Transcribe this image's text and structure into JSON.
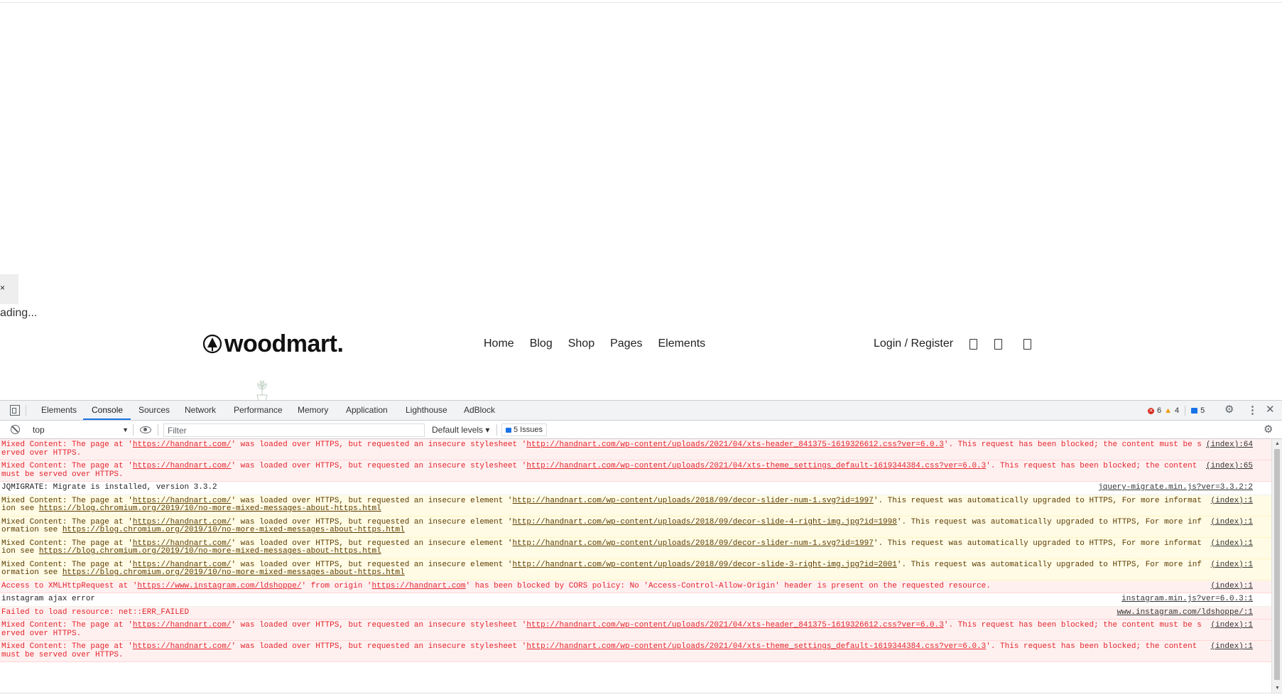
{
  "page": {
    "loader_close": "×",
    "loading_text": "ading...",
    "logo_text": "woodmart.",
    "nav": [
      "Home",
      "Blog",
      "Shop",
      "Pages",
      "Elements"
    ],
    "login": "Login / Register"
  },
  "devtools": {
    "tabs": [
      "Elements",
      "Console",
      "Sources",
      "Network",
      "Performance",
      "Memory",
      "Application",
      "Lighthouse",
      "AdBlock"
    ],
    "active_tab": "Console",
    "error_count": "6",
    "warning_count": "4",
    "message_count": "5",
    "context": "top",
    "filter_placeholder": "Filter",
    "levels": "Default levels ▾",
    "issues": "5 Issues",
    "messages": [
      {
        "level": "error",
        "parts": [
          "Mixed Content: The page at '",
          {
            "link": "https://handnart.com/"
          },
          "' was loaded over HTTPS, but requested an insecure stylesheet '",
          {
            "link": "http://handnart.com/wp-content/uploads/2021/04/xts-header_841375-1619326612.css?ver=6.0.3"
          },
          "'. This request has been blocked; the content must be served over HTTPS."
        ],
        "source": "(index):64"
      },
      {
        "level": "error",
        "parts": [
          "Mixed Content: The page at '",
          {
            "link": "https://handnart.com/"
          },
          "' was loaded over HTTPS, but requested an insecure stylesheet '",
          {
            "link": "http://handnart.com/wp-content/uploads/2021/04/xts-theme_settings_default-1619344384.css?ver=6.0.3"
          },
          "'. This request has been blocked; the content must be served over HTTPS."
        ],
        "source": "(index):65"
      },
      {
        "level": "info",
        "parts": [
          "JQMIGRATE: Migrate is installed, version 3.3.2"
        ],
        "source": "jquery-migrate.min.js?ver=3.3.2:2"
      },
      {
        "level": "warning",
        "parts": [
          "Mixed Content: The page at '",
          {
            "link": "https://handnart.com/"
          },
          "' was loaded over HTTPS, but requested an insecure element '",
          {
            "link": "http://handnart.com/wp-content/uploads/2018/09/decor-slider-num-1.svg?id=1997"
          },
          "'. This request was automatically upgraded to HTTPS, For more information see ",
          {
            "link": "https://blog.chromium.org/2019/10/no-more-mixed-messages-about-https.html"
          }
        ],
        "source": "(index):1"
      },
      {
        "level": "warning",
        "parts": [
          "Mixed Content: The page at '",
          {
            "link": "https://handnart.com/"
          },
          "' was loaded over HTTPS, but requested an insecure element '",
          {
            "link": "http://handnart.com/wp-content/uploads/2018/09/decor-slide-4-right-img.jpg?id=1998"
          },
          "'. This request was automatically upgraded to HTTPS, For more information see ",
          {
            "link": "https://blog.chromium.org/2019/10/no-more-mixed-messages-about-https.html"
          }
        ],
        "source": "(index):1"
      },
      {
        "level": "warning",
        "parts": [
          "Mixed Content: The page at '",
          {
            "link": "https://handnart.com/"
          },
          "' was loaded over HTTPS, but requested an insecure element '",
          {
            "link": "http://handnart.com/wp-content/uploads/2018/09/decor-slider-num-1.svg?id=1997"
          },
          "'. This request was automatically upgraded to HTTPS, For more information see ",
          {
            "link": "https://blog.chromium.org/2019/10/no-more-mixed-messages-about-https.html"
          }
        ],
        "source": "(index):1"
      },
      {
        "level": "warning",
        "parts": [
          "Mixed Content: The page at '",
          {
            "link": "https://handnart.com/"
          },
          "' was loaded over HTTPS, but requested an insecure element '",
          {
            "link": "http://handnart.com/wp-content/uploads/2018/09/decor-slide-3-right-img.jpg?id=2001"
          },
          "'. This request was automatically upgraded to HTTPS, For more information see ",
          {
            "link": "https://blog.chromium.org/2019/10/no-more-mixed-messages-about-https.html"
          }
        ],
        "source": "(index):1"
      },
      {
        "level": "error",
        "parts": [
          "Access to XMLHttpRequest at '",
          {
            "link": "https://www.instagram.com/ldshoppe/"
          },
          "' from origin '",
          {
            "link": "https://handnart.com"
          },
          "' has been blocked by CORS policy: No 'Access-Control-Allow-Origin' header is present on the requested resource."
        ],
        "source": "(index):1"
      },
      {
        "level": "info",
        "parts": [
          "instagram ajax error"
        ],
        "source": "instagram.min.js?ver=6.0.3:1"
      },
      {
        "level": "error",
        "parts": [
          "Failed to load resource: net::ERR_FAILED"
        ],
        "source": "www.instagram.com/ldshoppe/:1"
      },
      {
        "level": "error",
        "parts": [
          "Mixed Content: The page at '",
          {
            "link": "https://handnart.com/"
          },
          "' was loaded over HTTPS, but requested an insecure stylesheet '",
          {
            "link": "http://handnart.com/wp-content/uploads/2021/04/xts-header_841375-1619326612.css?ver=6.0.3"
          },
          "'. This request has been blocked; the content must be served over HTTPS."
        ],
        "source": "(index):1"
      },
      {
        "level": "error",
        "parts": [
          "Mixed Content: The page at '",
          {
            "link": "https://handnart.com/"
          },
          "' was loaded over HTTPS, but requested an insecure stylesheet '",
          {
            "link": "http://handnart.com/wp-content/uploads/2021/04/xts-theme_settings_default-1619344384.css?ver=6.0.3"
          },
          "'. This request has been blocked; the content must be served over HTTPS."
        ],
        "source": "(index):1"
      }
    ]
  },
  "colors": {
    "error_text": "#e3252c",
    "error_bg": "#fff0f0",
    "warning_text": "#5c3c00",
    "warning_bg": "#fffbe5",
    "accent": "#1a73e8"
  }
}
